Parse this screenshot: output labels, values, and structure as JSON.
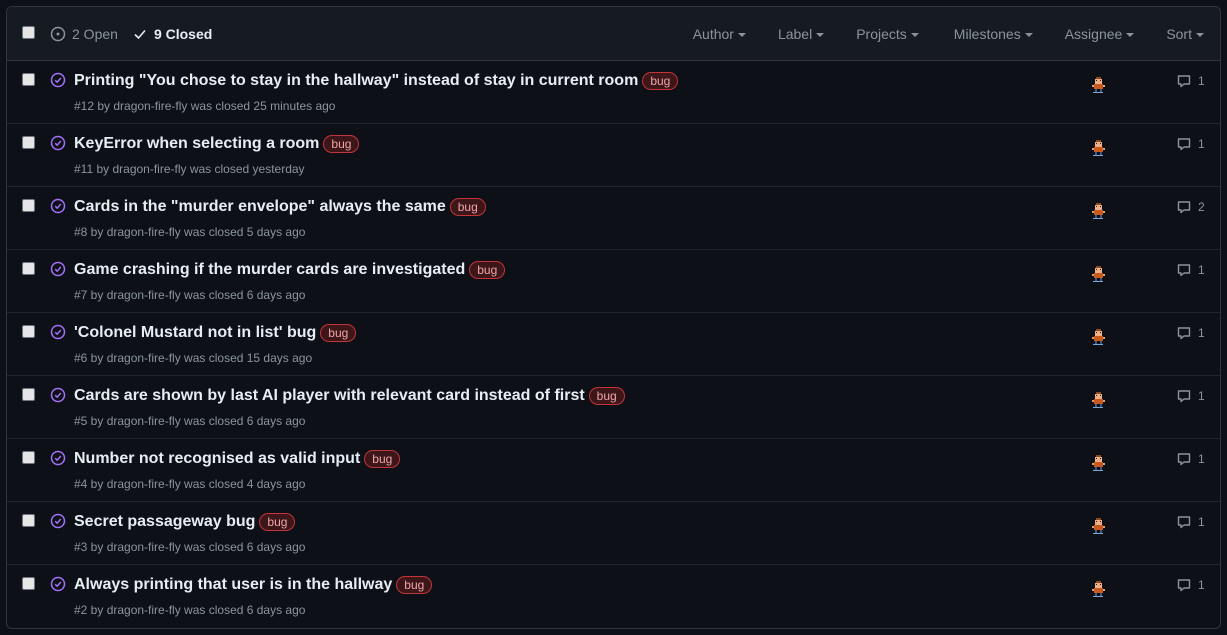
{
  "states": {
    "open_label": "2 Open",
    "closed_label": "9 Closed",
    "active": "closed"
  },
  "filters": [
    {
      "label": "Author"
    },
    {
      "label": "Label"
    },
    {
      "label": "Projects"
    },
    {
      "label": "Milestones"
    },
    {
      "label": "Assignee"
    },
    {
      "label": "Sort"
    }
  ],
  "issues": [
    {
      "title": "Printing \"You chose to stay in the hallway\" instead of stay in current room",
      "label": "bug",
      "meta": "#12 by dragon-fire-fly was closed 25 minutes ago",
      "comments": "1"
    },
    {
      "title": "KeyError when selecting a room",
      "label": "bug",
      "meta": "#11 by dragon-fire-fly was closed yesterday",
      "comments": "1"
    },
    {
      "title": "Cards in the \"murder envelope\" always the same",
      "label": "bug",
      "meta": "#8 by dragon-fire-fly was closed 5 days ago",
      "comments": "2"
    },
    {
      "title": "Game crashing if the murder cards are investigated",
      "label": "bug",
      "meta": "#7 by dragon-fire-fly was closed 6 days ago",
      "comments": "1"
    },
    {
      "title": "'Colonel Mustard not in list' bug",
      "label": "bug",
      "meta": "#6 by dragon-fire-fly was closed 15 days ago",
      "comments": "1"
    },
    {
      "title": "Cards are shown by last AI player with relevant card instead of first",
      "label": "bug",
      "meta": "#5 by dragon-fire-fly was closed 6 days ago",
      "comments": "1"
    },
    {
      "title": "Number not recognised as valid input",
      "label": "bug",
      "meta": "#4 by dragon-fire-fly was closed 4 days ago",
      "comments": "1"
    },
    {
      "title": "Secret passageway bug",
      "label": "bug",
      "meta": "#3 by dragon-fire-fly was closed 6 days ago",
      "comments": "1"
    },
    {
      "title": "Always printing that user is in the hallway",
      "label": "bug",
      "meta": "#2 by dragon-fire-fly was closed 6 days ago",
      "comments": "1"
    }
  ],
  "colors": {
    "closed_icon": "#a371f7",
    "label_border": "#c3343b",
    "label_text": "#f0a5a9"
  },
  "icons": {
    "open": "issue-opened-icon",
    "closed": "check-icon",
    "issue_closed": "issue-closed-icon",
    "comment": "comment-icon",
    "avatar": "avatar"
  }
}
